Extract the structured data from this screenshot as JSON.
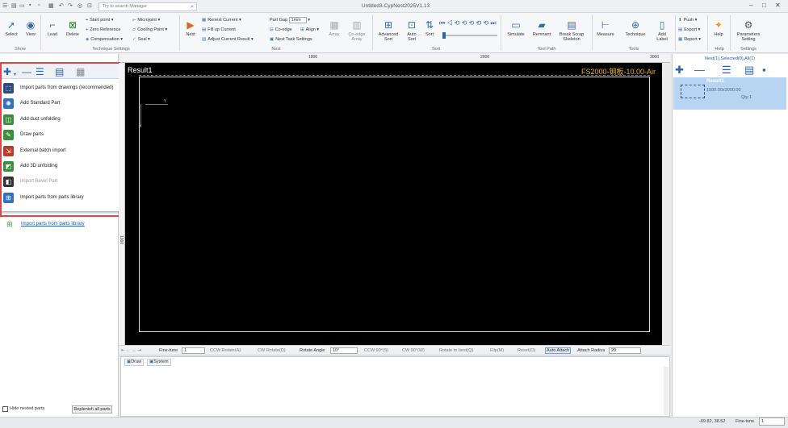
{
  "titlebar": {
    "search_placeholder": "Try to search Manager",
    "window_title": "Untitled3-CypNest2025V1.13",
    "minimize": "–",
    "maximize": "□",
    "close": "✕"
  },
  "ribbon": {
    "show_group": {
      "label": "Show",
      "select": "Select",
      "view": "View"
    },
    "technique_group": {
      "label": "Technique Settings",
      "lead": "Lead",
      "delete": "Delete",
      "start_point": "Start point",
      "zero_reference": "Zero Reference",
      "compensation": "Compensation",
      "microjoint": "Microjoint",
      "cooling_point": "Cooling Point",
      "seal": "Seal"
    },
    "nest_group": {
      "label": "Nest",
      "nest": "Nest",
      "renest_current": "Renest Current",
      "fill_up_current": "Fill up Current",
      "adjust_current_result": "Adjust Current Result",
      "part_gap_label": "Part Gap",
      "part_gap_value": "1mm",
      "co_edge": "Co-edge",
      "align": "Align",
      "nest_task_settings": "Nest Task Settings",
      "array": "Array",
      "co_edge_array": "Co-edge Array"
    },
    "sort_group": {
      "label": "Sort",
      "advanced_sort": "Advanced Sort",
      "auto_sort": "Auto Sort",
      "sort": "Sort"
    },
    "toolpath_group": {
      "label": "Tool Path",
      "simulate": "Simulate",
      "remnant": "Remnant",
      "break_scrap_skeleton": "Break Scrap Skeleton"
    },
    "tools_group": {
      "label": "Tools",
      "measure": "Measure",
      "technique": "Technique",
      "add_label": "Add Label"
    },
    "push_group": {
      "push": "Push",
      "export": "Export",
      "report": "Report"
    },
    "help_group": {
      "label": "Help",
      "help": "Help"
    },
    "settings_group": {
      "label": "Settings",
      "parameters_setting": "Parameters Setting"
    }
  },
  "left_panel": {
    "menu": [
      {
        "label": "Import parts from drawings (recommended)",
        "icon": "import-drawings-icon",
        "color": "#2b4c7e",
        "enabled": true
      },
      {
        "label": "Add Standard Part",
        "icon": "standard-part-icon",
        "color": "#2f72c4",
        "enabled": true
      },
      {
        "label": "Add duct unfolding",
        "icon": "duct-icon",
        "color": "#3b8e3b",
        "enabled": true
      },
      {
        "label": "Draw parts",
        "icon": "draw-parts-icon",
        "color": "#3b8e3b",
        "enabled": true
      },
      {
        "label": "External batch import",
        "icon": "batch-import-icon",
        "color": "#c0392b",
        "enabled": true
      },
      {
        "label": "Add 3D unfolding",
        "icon": "unfold-3d-icon",
        "color": "#3b8e3b",
        "enabled": true
      },
      {
        "label": "Import Bevel Part",
        "icon": "bevel-part-icon",
        "color": "#333333",
        "enabled": false
      },
      {
        "label": "Import parts from parts library",
        "icon": "parts-library-icon",
        "color": "#2f72c4",
        "enabled": true
      }
    ],
    "library_link": "Import parts from parts library",
    "hide_nested_parts": "Hide nested parts",
    "replenish_all_parts": "Replenish all parts"
  },
  "canvas": {
    "result_label": "Result1",
    "machine_label": "FS2000-钢板-10.00-Air",
    "axis_y": "Y",
    "axis_x": "X",
    "ruler_ticks_top": [
      "1000",
      "2000",
      "3000"
    ],
    "ruler_ticks_left": [
      "1000"
    ]
  },
  "operation_bar": {
    "fine_tune_label": "Fine-tune",
    "fine_tune_value": "1",
    "ccw_rotate": "CCW Rotate(A)",
    "cw_rotate": "CW Rotate(D)",
    "rotate_angle_label": "Rotate Angle",
    "rotate_angle_value": "10°",
    "ccw_90": "CCW 90°(S)",
    "cw_90": "CW 90°(W)",
    "rotate_to_best": "Rotate to best(Q)",
    "flip": "Flip(M)",
    "reset": "Reset(O)",
    "auto_attach": "Auto Attach",
    "attach_radius_label": "Attach Radius",
    "attach_radius_value": "20"
  },
  "log_pane": {
    "tab_draw": "Draw",
    "tab_system": "System"
  },
  "right_panel": {
    "nest_title": "Nest(1),Selected(0),All(1)",
    "result_title": "Result1",
    "result_dims": "1500.00x3000.00",
    "result_qty": "Qty:1"
  },
  "statusbar": {
    "coords": "-69.82, 38.52",
    "fine_tune_label": "Fine-tune",
    "fine_tune_value": "1"
  }
}
